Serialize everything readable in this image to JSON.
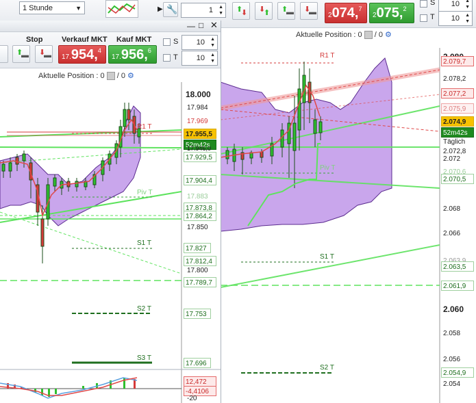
{
  "toolbar": {
    "timeframe": "1 Stunde",
    "qty_value": "1",
    "sell_price": {
      "prefix": "2",
      "main": "074,",
      "sup": "7"
    },
    "buy_price": {
      "prefix": "2",
      "main": "075,",
      "sup": "2"
    },
    "s_label": "S",
    "t_label": "T",
    "s_value": "10",
    "t_value": "10"
  },
  "left_panel": {
    "stop_label": "Stop",
    "verkauf_label": "Verkauf MKT",
    "kauf_label": "Kauf MKT",
    "sell_price": {
      "prefix": "17.",
      "main": "954,",
      "sup": "4"
    },
    "buy_price": {
      "prefix": "17.",
      "main": "956,",
      "sup": "6"
    },
    "s_label": "S",
    "t_label": "T",
    "s_value": "10",
    "t_value": "10",
    "position_text": "Aktuelle Position : 0",
    "position_slash": "/ 0",
    "axis_labels": [
      "18.000",
      "17.984",
      "17.969",
      "17.955,5",
      "52m42s",
      "17.946,0",
      "17.929,5",
      "17.904,4",
      "17.883",
      "17.873,8",
      "17.864,2",
      "17.850",
      "17.827",
      "17.812,4",
      "17.800",
      "17.789,7",
      "17.753",
      "17.696"
    ],
    "pivot_labels": {
      "r1": "R1 T",
      "pivot": "Piv T",
      "s1": "S1 T",
      "s2": "S2 T",
      "s3": "S3 T"
    },
    "macd_labels": [
      "12,472",
      "-4,4106",
      "-20"
    ]
  },
  "right_panel": {
    "position_text": "Aktuelle Position : 0",
    "position_slash": "/ 0",
    "axis_labels": [
      "2.080",
      "2.079,7",
      "2.078,2",
      "2.077,2",
      "2.075,9",
      "2.074,9",
      "52m42s",
      "Täglich",
      "2.072,8",
      "2.072",
      "2.070,6",
      "2.070,5",
      "2.068",
      "2.066",
      "2.063,9",
      "2.063,5",
      "2.061,9",
      "2.060",
      "2.058",
      "2.056",
      "2.054,9",
      "2.054"
    ],
    "pivot_labels": {
      "r1": "R1 T",
      "pivot": "Piv T",
      "s1": "S1 T",
      "s2": "S2 T"
    }
  },
  "colors": {
    "sell_red": "#d43a3a",
    "buy_green": "#3aa63a",
    "bollinger_fill": "#c9a6ec",
    "bollinger_edge": "#5b2b8f",
    "candle_green": "#2fbf2f",
    "trend_green": "#5ee35e",
    "trend_red": "#e04848"
  }
}
